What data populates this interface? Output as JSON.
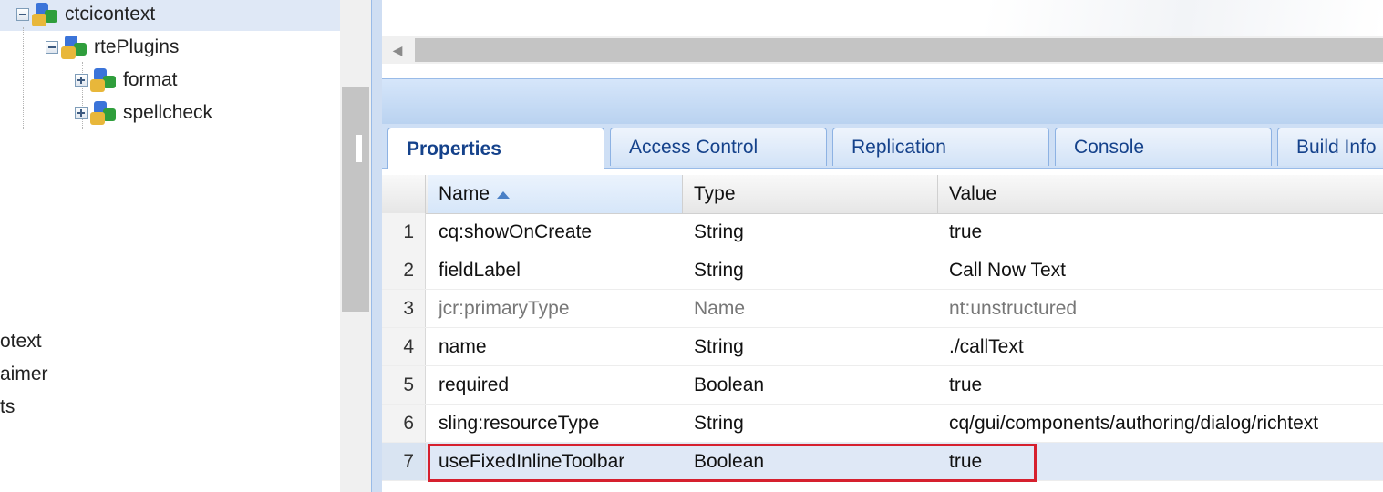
{
  "tree": {
    "nodes": [
      {
        "label": "ctcicontext",
        "expanded": true,
        "selected": true
      },
      {
        "label": "rtePlugins",
        "expanded": true,
        "selected": false
      },
      {
        "label": "format",
        "expanded": false,
        "selected": false
      },
      {
        "label": "spellcheck",
        "expanded": false,
        "selected": false
      }
    ],
    "partial_labels": [
      "otext",
      "aimer",
      "ts"
    ]
  },
  "tabs": [
    {
      "label": "Properties",
      "active": true
    },
    {
      "label": "Access Control",
      "active": false
    },
    {
      "label": "Replication",
      "active": false
    },
    {
      "label": "Console",
      "active": false
    },
    {
      "label": "Build Info",
      "active": false
    }
  ],
  "grid": {
    "columns": [
      "Name",
      "Type",
      "Value"
    ],
    "sort_column": "Name",
    "sort_direction": "ascending",
    "rows": [
      {
        "num": "1",
        "name": "cq:showOnCreate",
        "type": "String",
        "value": "true"
      },
      {
        "num": "2",
        "name": "fieldLabel",
        "type": "String",
        "value": "Call Now Text"
      },
      {
        "num": "3",
        "name": "jcr:primaryType",
        "type": "Name",
        "value": "nt:unstructured"
      },
      {
        "num": "4",
        "name": "name",
        "type": "String",
        "value": "./callText"
      },
      {
        "num": "5",
        "name": "required",
        "type": "Boolean",
        "value": "true"
      },
      {
        "num": "6",
        "name": "sling:resourceType",
        "type": "String",
        "value": "cq/gui/components/authoring/dialog/richtext"
      },
      {
        "num": "7",
        "name": "useFixedInlineToolbar",
        "type": "Boolean",
        "value": "true"
      }
    ],
    "selected_row": "7",
    "muted_row": "3"
  },
  "colors": {
    "selection": "#dfe8f6",
    "tab_text": "#15428b",
    "highlight_border": "#d6202e"
  }
}
